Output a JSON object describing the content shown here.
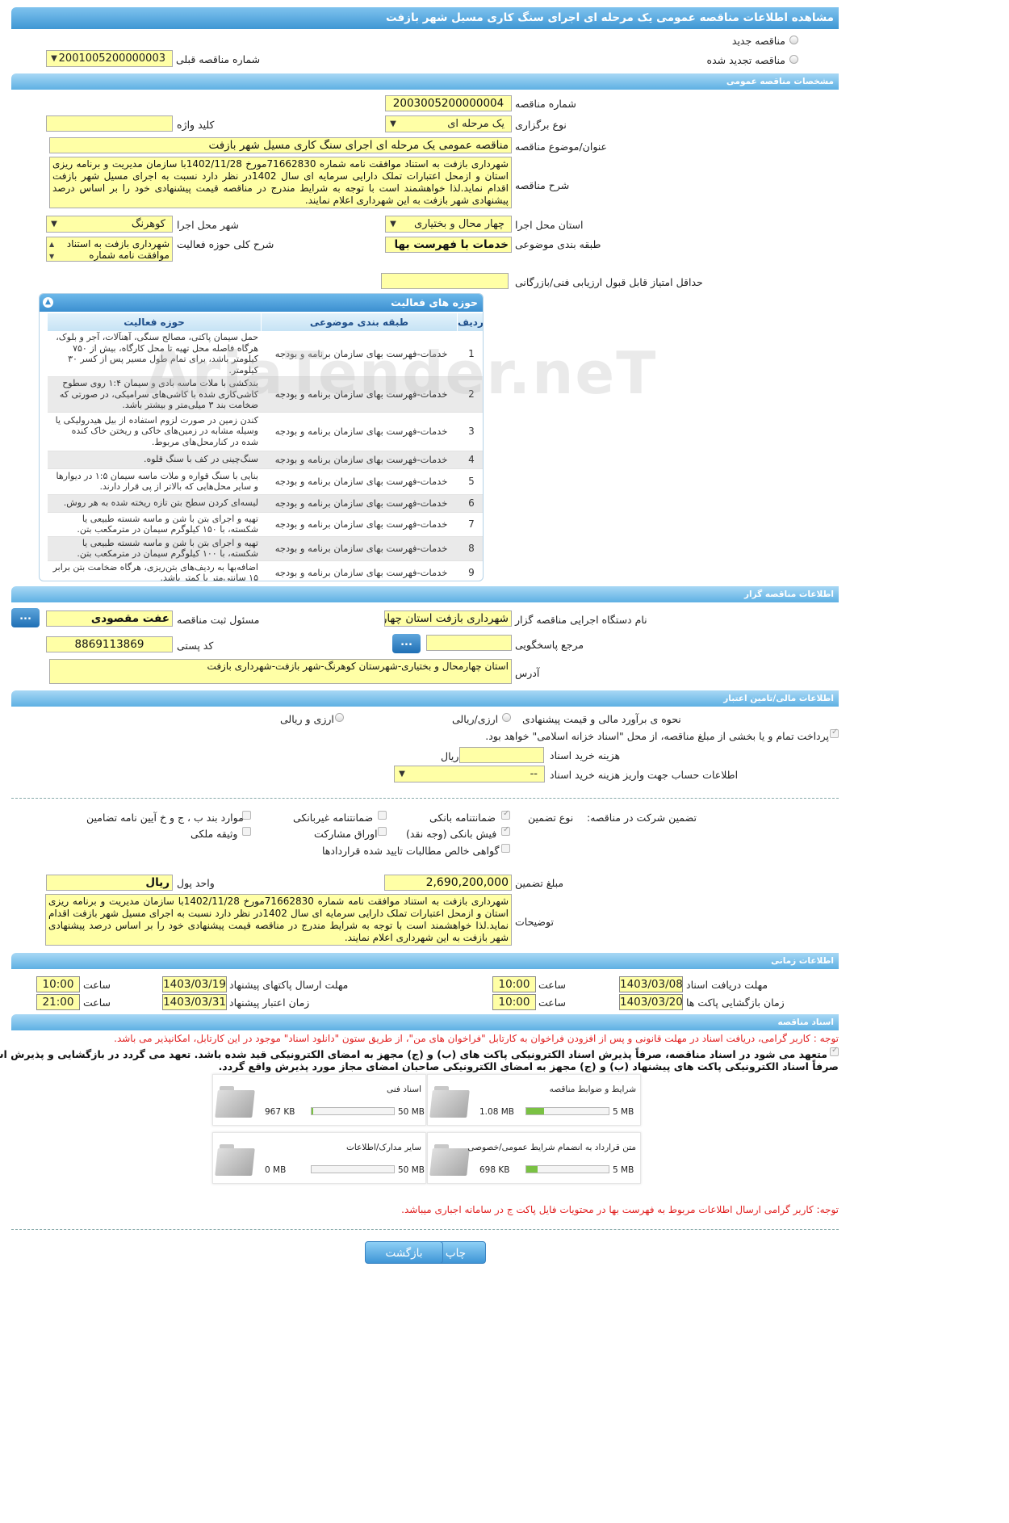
{
  "page": {
    "title": "مشاهده اطلاعات مناقصه عمومی یک مرحله ای اجرای سنگ کاری مسیل شهر بازفت"
  },
  "top": {
    "new_tender": "مناقصه جدید",
    "renewed_tender": "مناقصه تجدید شده",
    "prev_tender_label": "شماره مناقصه قبلی",
    "prev_tender_value": "2001005200000003"
  },
  "general": {
    "header": "مشخصات مناقصه عمومی",
    "tender_number_label": "شماره مناقصه",
    "tender_number": "2003005200000004",
    "hold_type_label": "نوع برگزاری",
    "hold_type": "یک مرحله ای",
    "keyword_label": "کلید واژه",
    "keyword": "",
    "subject_label": "عنوان/موضوع مناقصه",
    "subject": "مناقصه عمومی یک مرحله ای اجرای سنگ کاری مسیل شهر بازفت",
    "desc_label": "شرح مناقصه",
    "desc": "شهرداری بازفت به استناد موافقت نامه شماره 71662830مورخ 1402/11/28با سازمان مدیریت و برنامه ریزی استان  و ازمحل اعتبارات تملک دارایی سرمایه ای سال 1402در نظر دارد نسبت به اجرای مسیل شهر بازفت اقدام نماید.لذا خواهشمند است با توجه به شرایط مندرج در مناقصه قیمت پیشنهادی خود را بر اساس درصد پیشنهادی شهر بازفت به این شهرداری اعلام نمایند.",
    "province_label": "استان محل اجرا",
    "province": "چهار محال و بختیاری",
    "city_label": "شهر محل اجرا",
    "city": "کوهرنگ",
    "category_label": "طبقه بندی موضوعی",
    "category": "خدمات با فهرست بها",
    "scope_label": "شرح کلی حوزه فعالیت",
    "scope_line1": "شهرداری بازفت به استناد",
    "scope_line2": "موافقت نامه شماره",
    "min_score_label": "حداقل امتیاز قابل قبول ارزیابی فنی/بازرگانی",
    "min_score": ""
  },
  "activities": {
    "header": "حوزه های فعالیت",
    "col_row": "ردیف",
    "col_category": "طبقه بندی موضوعی",
    "col_field": "حوزه فعالیت",
    "rows": [
      {
        "num": "1",
        "category": "خدمات-فهرست بهای سازمان برنامه و بودجه",
        "desc": "حمل سیمان پاکتی، مصالح سنگی، آهنآلات، آجر و بلوک، هرگاه فاصله محل تهیه تا محل کارگاه، بیش از ۷۵۰ کیلومتر باشد، برای تمام طول مسیر پس از کسر ۳۰ کیلومتر."
      },
      {
        "num": "2",
        "category": "خدمات-فهرست بهای سازمان برنامه و بودجه",
        "desc": "بندکشی با ملات ماسه بادی و سیمان ۱:۴ روی سطوح کاشی‌کاری شده با کاشی‌های سرامیکی، در صورتی که ضخامت بند ۳ میلی‌متر و بیشتر باشد."
      },
      {
        "num": "3",
        "category": "خدمات-فهرست بهای سازمان برنامه و بودجه",
        "desc": "کندن زمین در صورت لزوم استفاده از بیل هیدرولیکی یا وسیله مشابه در زمین‌های خاکی و ریختن خاک کنده شده در کنارمحل‌های مربوط."
      },
      {
        "num": "4",
        "category": "خدمات-فهرست بهای سازمان برنامه و بودجه",
        "desc": "سنگ‌چینی در کف با سنگ قلوه."
      },
      {
        "num": "5",
        "category": "خدمات-فهرست بهای سازمان برنامه و بودجه",
        "desc": "بنایی با سنگ قواره و ملات ماسه سیمان ۱:۵ در دیوارها و سایر محل‌هایی که بالاتر از پی قرار دارند."
      },
      {
        "num": "6",
        "category": "خدمات-فهرست بهای سازمان برنامه و بودجه",
        "desc": "لیسه‌ای کردن سطح بتن تازه ریخته شده به هر روش."
      },
      {
        "num": "7",
        "category": "خدمات-فهرست بهای سازمان برنامه و بودجه",
        "desc": "تهیه و اجرای بتن با شن و ماسه شسته طبیعی یا شکسته، با ۱۵۰ کیلوگرم سیمان در مترمکعب بتن."
      },
      {
        "num": "8",
        "category": "خدمات-فهرست بهای سازمان برنامه و بودجه",
        "desc": "تهیه و اجرای بتن با شن و ماسه شسته طبیعی یا شکسته، با ۱۰۰ کیلوگرم سیمان در مترمکعب بتن."
      },
      {
        "num": "9",
        "category": "خدمات-فهرست بهای سازمان برنامه و بودجه",
        "desc": "اضافه‌بها به ردیف‌های بتن‌ریزی، هرگاه ضخامت بتن برابر ۱۵ سانتی‌متر یا کمتر باشد."
      }
    ]
  },
  "organizer": {
    "header": "اطلاعات مناقصه گزار",
    "org_label": "نام دستگاه اجرایی مناقصه گزار",
    "org": "شهرداری بازفت استان چهار",
    "resp_label": "مسئول ثبت مناقصه",
    "resp": "عفت مقصودی",
    "ref_label": "مرجع پاسخگویی",
    "ref": "",
    "postal_label": "کد پستی",
    "postal": "8869113869",
    "address_label": "آدرس",
    "address": "استان چهارمحال و بختیاری-شهرستان کوهرنگ-شهر بازفت-شهرداری بازفت",
    "dots": "..."
  },
  "finance": {
    "header": "اطلاعات مالی/تامین اعتبار",
    "method_label": "نحوه ی برآورد مالی و قیمت پیشنهادی",
    "rial": "ارزی/ریالی",
    "fx_rial": "ارزی و ریالی",
    "treasury_note": "پرداخت تمام و یا بخشی از مبلغ مناقصه، از محل \"اسناد خزانه اسلامی\" خواهد بود.",
    "doc_fee_label": "هزینه خرید اسناد",
    "doc_fee": "",
    "rial_unit": "ریال",
    "account_label": "اطلاعات حساب جهت واریز هزینه خرید اسناد",
    "account": "--"
  },
  "guarantee": {
    "participation_label": "تضمین شرکت در مناقصه:",
    "type_label": "نوع تضمین",
    "bank_guarantee": "ضمانتنامه بانکی",
    "nonbank_guarantee": "ضمانتنامه غیربانکی",
    "articles": "موارد بند ب ، ج و خ آیین نامه تضامین",
    "bank_receipt": "فیش بانکی (وجه نقد)",
    "shares": "اوراق مشارکت",
    "property": "وثیقه ملکی",
    "net_claims": "گواهی خالص مطالبات تایید شده قراردادها",
    "amount_label": "مبلغ تضمین",
    "amount": "2,690,200,000",
    "unit_label": "واحد پول",
    "unit": "ریال",
    "notes_label": "توضیحات",
    "notes": "شهرداری بازفت به استناد موافقت نامه شماره 71662830مورخ 1402/11/28با سازمان مدیریت و برنامه ریزی استان  و ازمحل اعتبارات تملک دارایی سرمایه ای سال 1402در نظر دارد نسبت به اجرای مسیل شهر بازفت اقدام نماید.لذا خواهشمند است با توجه به شرایط مندرج در مناقصه قیمت پیشنهادی خود را بر اساس درصد پیشنهادی شهر بازفت به این شهرداری اعلام نمایند."
  },
  "schedule": {
    "header": "اطلاعات زمانی",
    "receive_label": "مهلت دریافت اسناد",
    "receive_date": "1403/03/08",
    "receive_time": "10:00",
    "send_label": "مهلت ارسال پاکتهای پیشنهاد",
    "send_date": "1403/03/19",
    "send_time": "10:00",
    "open_label": "زمان بازگشایی پاکت ها",
    "open_date": "1403/03/20",
    "open_time": "10:00",
    "valid_label": "زمان اعتبار پیشنهاد",
    "valid_date": "1403/03/31",
    "valid_time": "21:00",
    "time_label": "ساعت"
  },
  "documents": {
    "header": "اسناد مناقصه",
    "notice1": "توجه : کاربر گرامی، دریافت اسناد در مهلت قانونی و پس از افزودن فراخوان به کارتابل \"فراخوان های من\"، از طریق ستون \"دانلود اسناد\" موجود در این کارتابل، امکانپذیر می باشد.",
    "commit1": "متعهد می شود در اسناد مناقصه، صرفاً پذیرش اسناد الکترونیکی پاکت های (ب) و (ج) مجهز به امضای الکترونیکی قید شده باشد. تعهد می گردد در بازگشایی و پذیرش اسناد،",
    "commit2": "صرفاً اسناد الکترونیکی پاکت های پیشنهاد (ب) و (ج) مجهز به امضای الکترونیکی صاحبان امضای مجاز مورد پذیرش واقع گردد.",
    "cards": [
      {
        "title": "شرایط و ضوابط مناقصه",
        "size": "1.08 MB",
        "max": "5 MB",
        "fill": 0.22
      },
      {
        "title": "اسناد فنی",
        "size": "967 KB",
        "max": "50 MB",
        "fill": 0.02
      },
      {
        "title": "متن قرارداد به انضمام شرایط عمومی/خصوصی",
        "size": "698 KB",
        "max": "5 MB",
        "fill": 0.14
      },
      {
        "title": "سایر مدارک/اطلاعات",
        "size": "0 MB",
        "max": "50 MB",
        "fill": 0
      }
    ],
    "notice2": "توجه: کاربر گرامی ارسال اطلاعات مربوط به فهرست بها در محتویات فایل پاکت ج در سامانه اجباری میباشد."
  },
  "buttons": {
    "print": "چاپ",
    "back": "بازگشت"
  },
  "watermark": "AriaTender.neT"
}
